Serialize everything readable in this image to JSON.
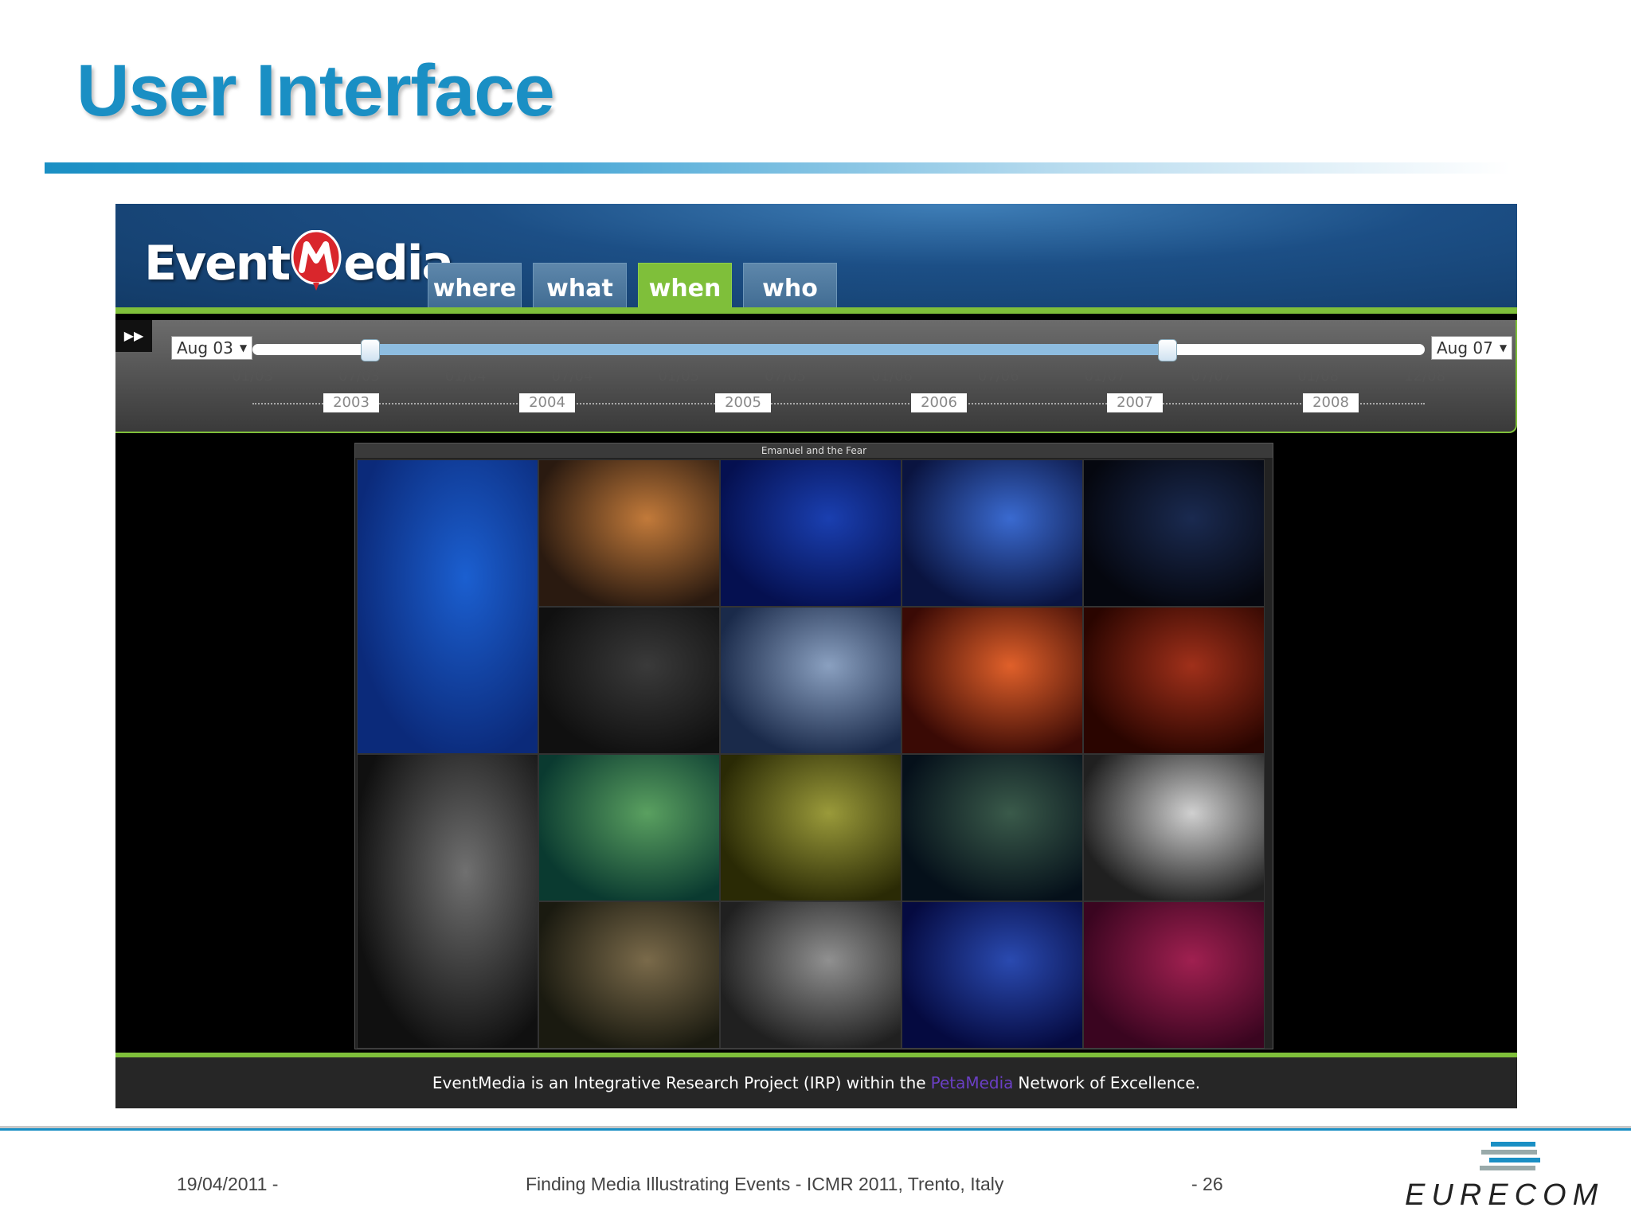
{
  "slide": {
    "title": "User Interface"
  },
  "app": {
    "logo_text_left": "Event",
    "logo_text_right": "edia",
    "tabs": [
      {
        "label": "where",
        "active": false
      },
      {
        "label": "what",
        "active": false
      },
      {
        "label": "when",
        "active": true
      },
      {
        "label": "who",
        "active": false
      }
    ],
    "timeline": {
      "start_select": "Aug 03",
      "end_select": "Aug 07",
      "range_start_fraction": 0.1,
      "range_end_fraction": 0.78,
      "ticks": [
        "01/03",
        "07/03",
        "01/04",
        "07/04",
        "01/05",
        "07/05",
        "01/06",
        "07/06",
        "01/07",
        "07/07",
        "01/08",
        "12/08"
      ],
      "years": [
        "2003",
        "2004",
        "2005",
        "2006",
        "2007",
        "2008"
      ]
    },
    "gallery": {
      "title": "Emanuel and the Fear"
    },
    "footer": {
      "text_before": "EventMedia is an Integrative Research Project (IRP) within the",
      "link": "PetaMedia",
      "text_after": "Network of Excellence."
    }
  },
  "footer": {
    "date": "19/04/2011 -",
    "event": "Finding Media Illustrating Events - ICMR 2011, Trento, Italy",
    "page": "- 26",
    "brand": "EURECOM"
  },
  "colors": {
    "title_blue": "#1a8fc4",
    "accent_green": "#7fbf3a"
  }
}
